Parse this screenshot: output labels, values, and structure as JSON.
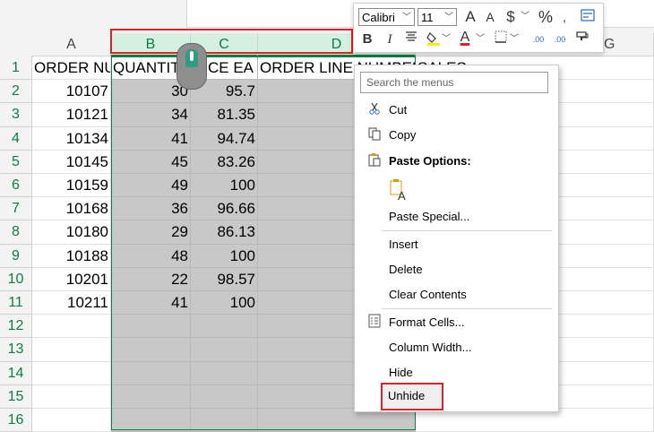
{
  "columns": [
    {
      "letter": "A",
      "left": 0
    },
    {
      "letter": "B"
    },
    {
      "letter": "C"
    },
    {
      "letter": "D"
    },
    {
      "letter": "G"
    }
  ],
  "header_row": {
    "a": "ORDER NU",
    "b": "QUANTITY",
    "c": "RICE EA",
    "d": "ORDER LINE NUMBER",
    "e": "SALES"
  },
  "rows": [
    {
      "n": "1"
    },
    {
      "n": "2",
      "a": "10107",
      "b": "30",
      "c": "95.7"
    },
    {
      "n": "3",
      "a": "10121",
      "b": "34",
      "c": "81.35"
    },
    {
      "n": "4",
      "a": "10134",
      "b": "41",
      "c": "94.74"
    },
    {
      "n": "5",
      "a": "10145",
      "b": "45",
      "c": "83.26"
    },
    {
      "n": "6",
      "a": "10159",
      "b": "49",
      "c": "100"
    },
    {
      "n": "7",
      "a": "10168",
      "b": "36",
      "c": "96.66"
    },
    {
      "n": "8",
      "a": "10180",
      "b": "29",
      "c": "86.13"
    },
    {
      "n": "9",
      "a": "10188",
      "b": "48",
      "c": "100"
    },
    {
      "n": "10",
      "a": "10201",
      "b": "22",
      "c": "98.57"
    },
    {
      "n": "11",
      "a": "10211",
      "b": "41",
      "c": "100"
    },
    {
      "n": "12"
    },
    {
      "n": "13"
    },
    {
      "n": "14"
    },
    {
      "n": "15"
    },
    {
      "n": "16"
    }
  ],
  "mini_toolbar": {
    "font_name": "Calibri",
    "font_size": "11",
    "grow_font": "A",
    "shrink_font": "A",
    "currency": "$",
    "percent": "%",
    "bold": "B",
    "italic": "I",
    "font_color": "A",
    "decimals_increase": ".00",
    "decimals_decrease": ".00"
  },
  "context_menu": {
    "search_placeholder": "Search the menus",
    "cut": "Cut",
    "copy": "Copy",
    "paste_options": "Paste Options:",
    "paste_special": "Paste Special...",
    "insert": "Insert",
    "delete": "Delete",
    "clear_contents": "Clear Contents",
    "format_cells": "Format Cells...",
    "column_width": "Column Width...",
    "hide": "Hide",
    "unhide": "Unhide"
  },
  "colors": {
    "excel_green": "#107c41",
    "highlight_red": "#e0202b",
    "selected_fill": "#c8c8c8"
  }
}
